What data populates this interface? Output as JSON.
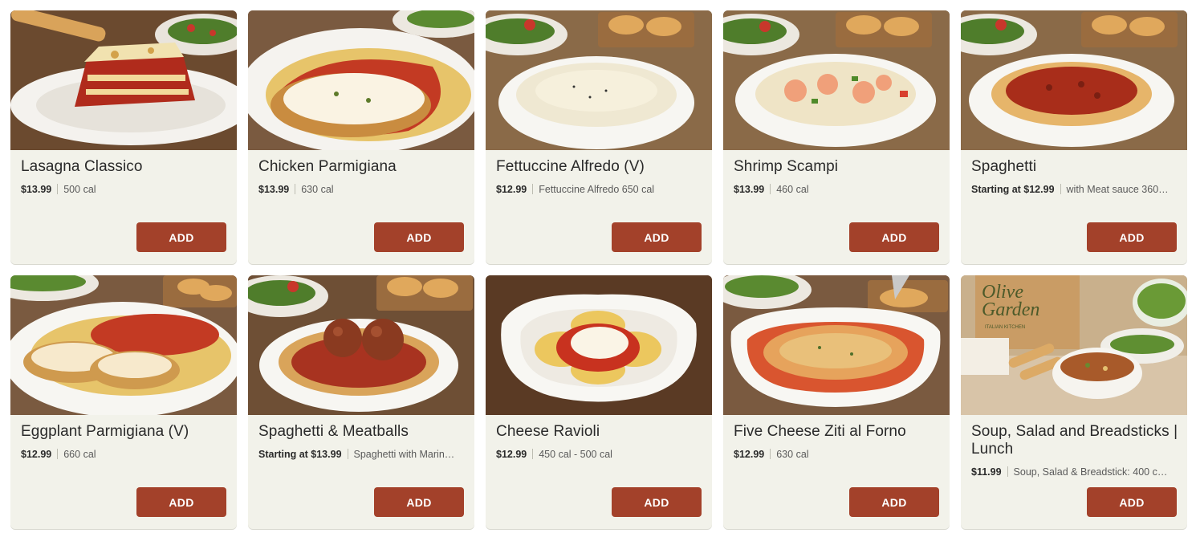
{
  "menu": {
    "add_label": "ADD",
    "items": [
      {
        "name": "Lasagna Classico",
        "price": "$13.99",
        "calories": "500 cal",
        "image": "lasagna"
      },
      {
        "name": "Chicken Parmigiana",
        "price": "$13.99",
        "calories": "630 cal",
        "image": "chicken-parm"
      },
      {
        "name": "Fettuccine Alfredo (V)",
        "price": "$12.99",
        "calories": "Fettuccine Alfredo 650 cal",
        "image": "fettuccine"
      },
      {
        "name": "Shrimp Scampi",
        "price": "$13.99",
        "calories": "460 cal",
        "image": "shrimp"
      },
      {
        "name": "Spaghetti",
        "price": "Starting at $12.99",
        "calories": "with Meat sauce 360…",
        "image": "spaghetti"
      },
      {
        "name": "Eggplant Parmigiana (V)",
        "price": "$12.99",
        "calories": "660 cal",
        "image": "eggplant"
      },
      {
        "name": "Spaghetti & Meatballs",
        "price": "Starting at $13.99",
        "calories": "Spaghetti with Marin…",
        "image": "meatballs"
      },
      {
        "name": "Cheese Ravioli",
        "price": "$12.99",
        "calories": "450 cal - 500 cal",
        "image": "ravioli"
      },
      {
        "name": "Five Cheese Ziti al Forno",
        "price": "$12.99",
        "calories": "630 cal",
        "image": "ziti"
      },
      {
        "name": "Soup, Salad and Breadsticks | Lunch",
        "price": "$11.99",
        "calories": "Soup, Salad & Breadstick: 400 c…",
        "image": "soup-salad",
        "brand_logo": "Olive Garden",
        "brand_sub": "ITALIAN KITCHEN"
      }
    ]
  }
}
